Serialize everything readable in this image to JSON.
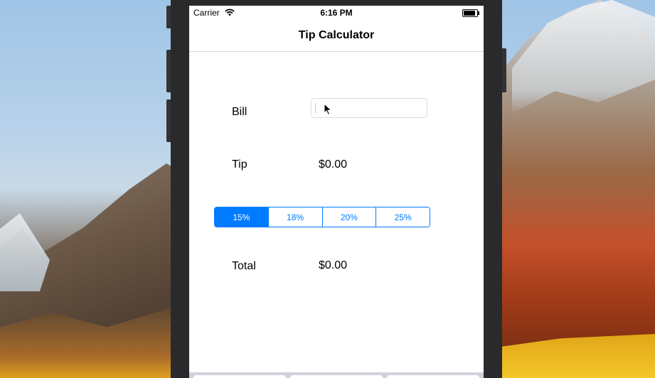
{
  "status_bar": {
    "carrier": "Carrier",
    "time": "6:16 PM"
  },
  "nav": {
    "title": "Tip Calculator"
  },
  "bill": {
    "label": "Bill",
    "value": ""
  },
  "tip": {
    "label": "Tip",
    "value": "$0.00"
  },
  "tip_options": {
    "selected_index": 0,
    "items": [
      "15%",
      "18%",
      "20%",
      "25%"
    ]
  },
  "total": {
    "label": "Total",
    "value": "$0.00"
  },
  "colors": {
    "accent": "#007aff",
    "text": "#000000",
    "background": "#ffffff"
  },
  "icons": {
    "wifi": "wifi-icon",
    "battery": "battery-icon",
    "cursor": "mouse-pointer-icon"
  }
}
